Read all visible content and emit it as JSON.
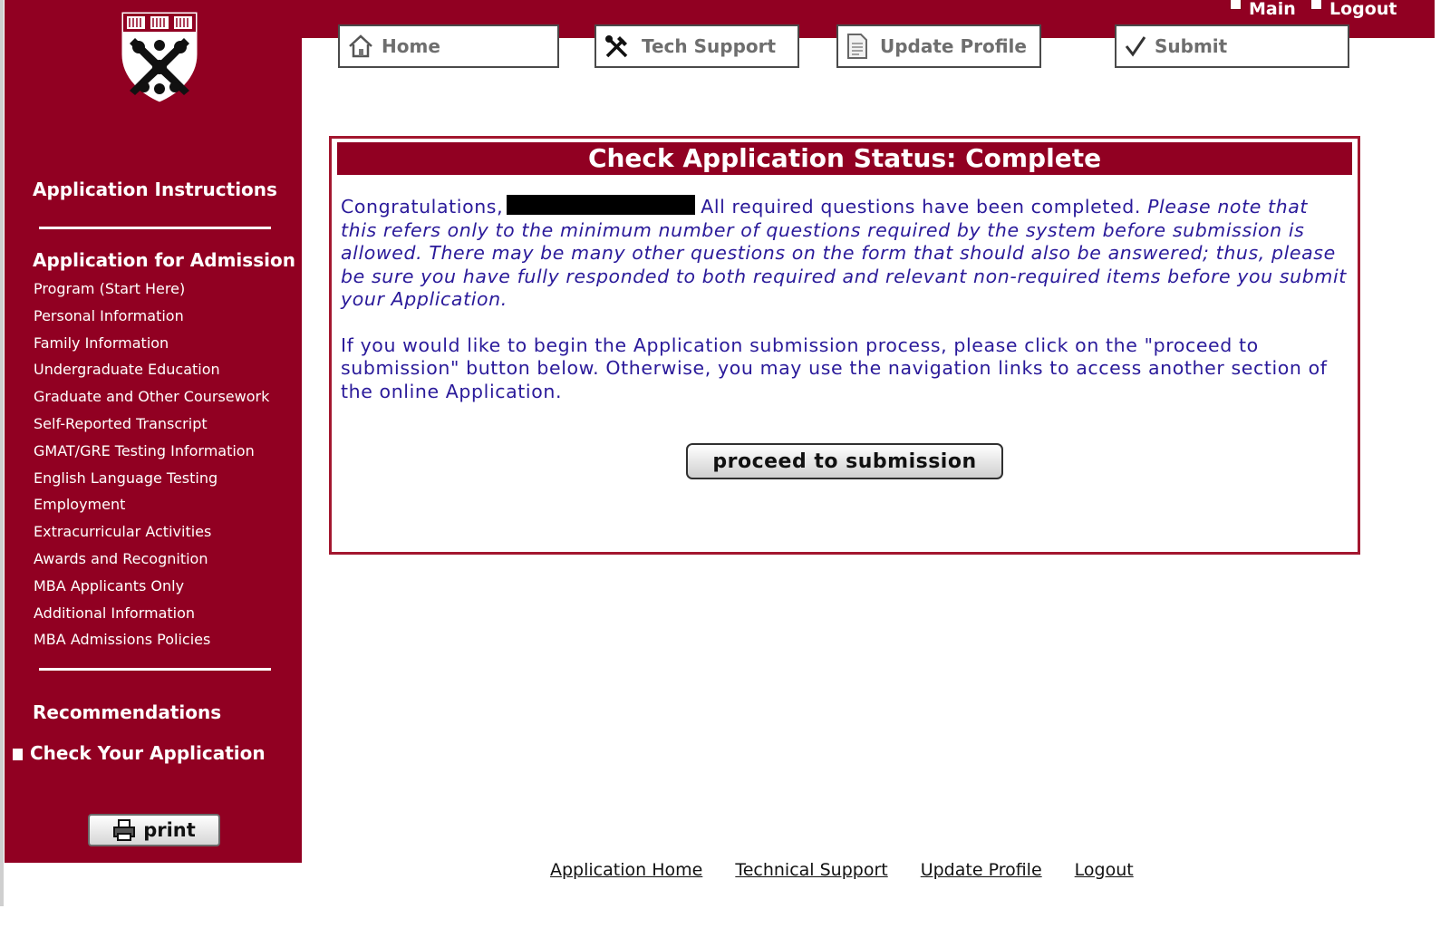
{
  "top_nav": {
    "main_label": "Main",
    "logout_label": "Logout"
  },
  "toolbar": {
    "home_label": "Home",
    "tech_support_label": "Tech Support",
    "update_profile_label": "Update Profile",
    "submit_label": "Submit"
  },
  "sidebar": {
    "application_instructions": "Application Instructions",
    "application_for_admission": "Application for Admission",
    "items": [
      "Program (Start Here)",
      "Personal Information",
      "Family Information",
      "Undergraduate Education",
      "Graduate and Other Coursework",
      "Self-Reported Transcript",
      "GMAT/GRE Testing Information",
      "English Language Testing",
      "Employment",
      "Extracurricular Activities",
      "Awards and Recognition",
      "MBA Applicants Only",
      "Additional Information",
      "MBA Admissions Policies"
    ],
    "recommendations": "Recommendations",
    "check_your_application": "Check Your Application",
    "print_label": "print"
  },
  "status": {
    "title": "Check Application Status: Complete",
    "congrats_prefix": "Congratulations,",
    "completed_text": "All required questions have been completed.",
    "note_text": "Please note that this refers only to the minimum number of questions required by the system before submission is allowed. There may be many other questions on the form that should also be answered; thus, please be sure you have fully responded to both required and relevant non-required items before you submit your Application.",
    "proceed_text": "If you would like to begin the Application submission process, please click on the \"proceed to submission\" button below. Otherwise, you may use the navigation links to access another section of the online Application.",
    "proceed_button": "proceed to submission"
  },
  "footer": {
    "links": [
      "Application Home",
      "Technical Support",
      "Update Profile",
      "Logout"
    ]
  },
  "colors": {
    "brand": "#910022",
    "body_text": "#2a1a9a"
  }
}
